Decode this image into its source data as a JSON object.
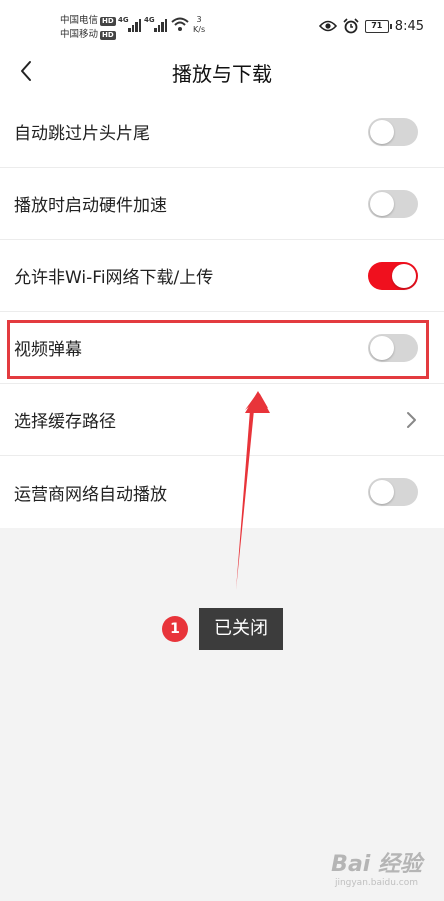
{
  "status_bar": {
    "carrier1": "中国电信",
    "carrier2": "中国移动",
    "hd": "HD",
    "net1": "4G",
    "net2": "4G",
    "speed_value": "3",
    "speed_unit": "K/s",
    "battery": "71",
    "time": "8:45"
  },
  "header": {
    "title": "播放与下载"
  },
  "settings": {
    "items": [
      {
        "label": "自动跳过片头片尾",
        "control": "toggle",
        "on": false
      },
      {
        "label": "播放时启动硬件加速",
        "control": "toggle",
        "on": false
      },
      {
        "label": "允许非Wi-Fi网络下载/上传",
        "control": "toggle",
        "on": true
      },
      {
        "label": "视频弹幕",
        "control": "toggle",
        "on": false
      },
      {
        "label": "选择缓存路径",
        "control": "chevron"
      },
      {
        "label": "运营商网络自动播放",
        "control": "toggle",
        "on": false
      }
    ]
  },
  "annotation": {
    "step": "1",
    "text": "已关闭"
  },
  "watermark": {
    "text": "Bai 经验",
    "sub": "jingyan.baidu.com"
  },
  "colors": {
    "accent": "#f0101e",
    "highlight": "#e33b3f",
    "toggle_off": "#d6d6d6",
    "tip_bg": "#3c3c3c"
  }
}
